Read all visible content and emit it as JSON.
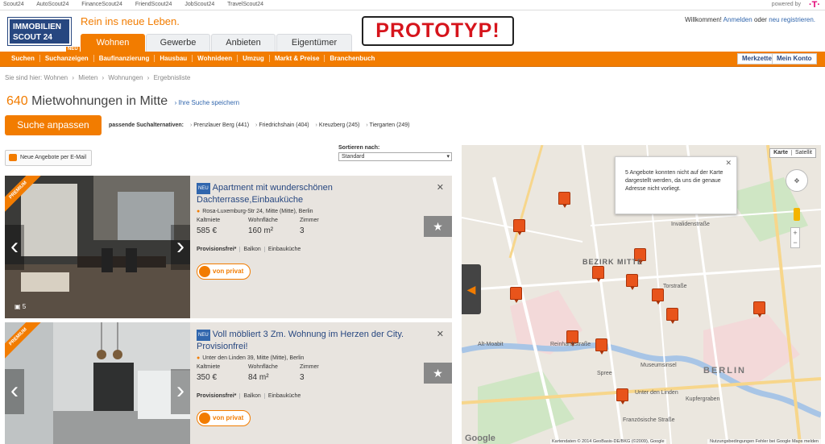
{
  "topbar": {
    "links": [
      "Scout24",
      "AutoScout24",
      "FinanceScout24",
      "FriendScout24",
      "JobScout24",
      "TravelScout24"
    ],
    "powered": "powered by",
    "brand": "·T·"
  },
  "logo": {
    "line1": "IMMOBILIEN",
    "line2": "SCOUT 24"
  },
  "slogan": "Rein ins neue Leben.",
  "prototype": "PROTOTYP!",
  "welcome": {
    "prefix": "Willkommen!",
    "login": "Anmelden",
    "or": "oder",
    "register": "neu registrieren."
  },
  "tabs": [
    "Wohnen",
    "Gewerbe",
    "Anbieten",
    "Eigentümer"
  ],
  "nav": {
    "items": [
      "Suchen",
      "Suchanzeigen",
      "Baufinanzierung",
      "Hausbau",
      "Wohnideen",
      "Umzug",
      "Markt & Preise",
      "Branchenbuch"
    ],
    "badge": "NEU",
    "merkzettel": "Merkzettel",
    "konto": "Mein Konto"
  },
  "breadcrumb": [
    "Sie sind hier: Wohnen",
    "›",
    "Mieten",
    "›",
    "Wohnungen",
    "›",
    "Ergebnisliste"
  ],
  "heading": {
    "count": "640",
    "title": "Mietwohnungen in Mitte",
    "save": "› Ihre Suche speichern"
  },
  "search_button": "Suche anpassen",
  "alternatives": {
    "label": "passende Suchalternativen:",
    "items": [
      "Prenzlauer Berg (441)",
      "Friedrichshain (404)",
      "Kreuzberg (245)",
      "Tiergarten (249)"
    ]
  },
  "mail_button": "Neue Angebote per E-Mail",
  "sort": {
    "label": "Sortieren nach:",
    "value": "Standard"
  },
  "listings": [
    {
      "premium": "PREMIUM",
      "badge": "NEU",
      "title": "Apartment mit wunderschönen Dachterrasse,Einbauküche",
      "address": "Rosa-Luxemburg-Str 24, Mitte (Mitte), Berlin",
      "stats": [
        {
          "k": "Kaltmiete",
          "v": "585 €"
        },
        {
          "k": "Wohnfläche",
          "v": "160 m²"
        },
        {
          "k": "Zimmer",
          "v": "3"
        }
      ],
      "features": [
        "Provisionsfrei*",
        "Balkon",
        "Einbauküche"
      ],
      "private": "von privat",
      "photos": "5"
    },
    {
      "premium": "PREMIUM",
      "badge": "NEU",
      "title": "Voll möbliert 3 Zm. Wohnung im Herzen der City. Provisionfrei!",
      "address": "Unter den Linden 39, Mitte (Mitte), Berlin",
      "stats": [
        {
          "k": "Kaltmiete",
          "v": "350 €"
        },
        {
          "k": "Wohnfläche",
          "v": "84 m²"
        },
        {
          "k": "Zimmer",
          "v": "3"
        }
      ],
      "features": [
        "Provisionsfrei*",
        "Balkon",
        "Einbauküche"
      ],
      "private": "von privat"
    }
  ],
  "map": {
    "info": "5 Angebote konnten nicht auf der Karte dargestellt werden, da uns die genaue Adresse nicht vorliegt.",
    "types": [
      "Karte",
      "Satellit"
    ],
    "labels": [
      "BEZIRK MITTE",
      "BERLIN",
      "Museumsinsel",
      "Unter den Linden",
      "Torstraße",
      "Invalidenstraße",
      "Spree",
      "Kupfergraben",
      "Französische Straße",
      "Reinhardtstraße",
      "Alt-Moabit"
    ],
    "google": "Google",
    "copyright": "Kartendaten © 2014 GeoBasis-DE/BKG (©2009), Google",
    "terms": "Nutzungsbedingungen   Fehler bei Google Maps melden"
  },
  "colors": {
    "accent": "#f27c00",
    "brand": "#274780",
    "link": "#3166ad"
  }
}
